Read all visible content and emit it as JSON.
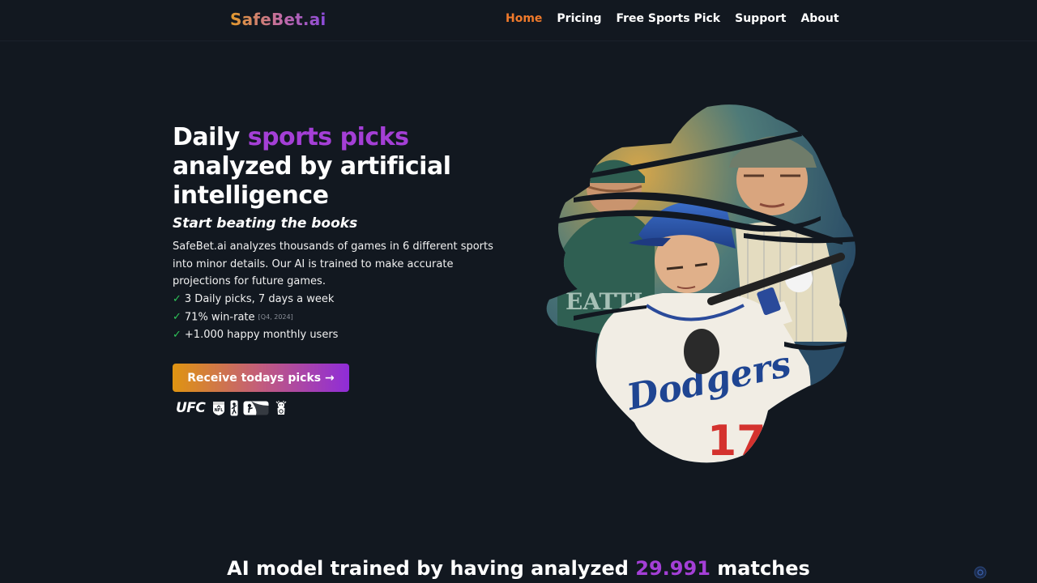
{
  "nav": {
    "logo": "SafeBet.ai",
    "items": [
      {
        "label": "Home",
        "active": true
      },
      {
        "label": "Pricing"
      },
      {
        "label": "Free Sports Pick"
      },
      {
        "label": "Support"
      },
      {
        "label": "About"
      }
    ]
  },
  "hero": {
    "title_part1": "Daily ",
    "title_highlight": "sports picks",
    "title_part2": " analyzed by artificial intelligence",
    "subtitle": "Start beating the books",
    "description": "SafeBet.ai analyzes thousands of games in 6 different sports into minor details. Our AI is trained to make accurate projections for future games.",
    "features": [
      {
        "text": "3 Daily picks, 7 days a week"
      },
      {
        "text": "71% win-rate",
        "note": "[Q4, 2024]"
      },
      {
        "text": "+1.000 happy monthly users"
      }
    ],
    "check_icon": "✓",
    "cta_label": "Receive todays picks →",
    "leagues": {
      "ufc": "UFC",
      "icons": [
        "nfl-logo",
        "nba-logo",
        "mlb-logo",
        "premier-league-logo"
      ]
    },
    "illustration": "baseball-players-painting"
  },
  "section": {
    "title_part1": "AI model trained by having analyzed ",
    "title_highlight": "29.991",
    "title_part2": " matches"
  },
  "colors": {
    "background": "#121820",
    "accent_purple": "#a43fd6",
    "nav_active": "#f07a2b",
    "check_green": "#2fc55a",
    "cta_gradient": [
      "#df9411",
      "#8f2cd8"
    ]
  }
}
